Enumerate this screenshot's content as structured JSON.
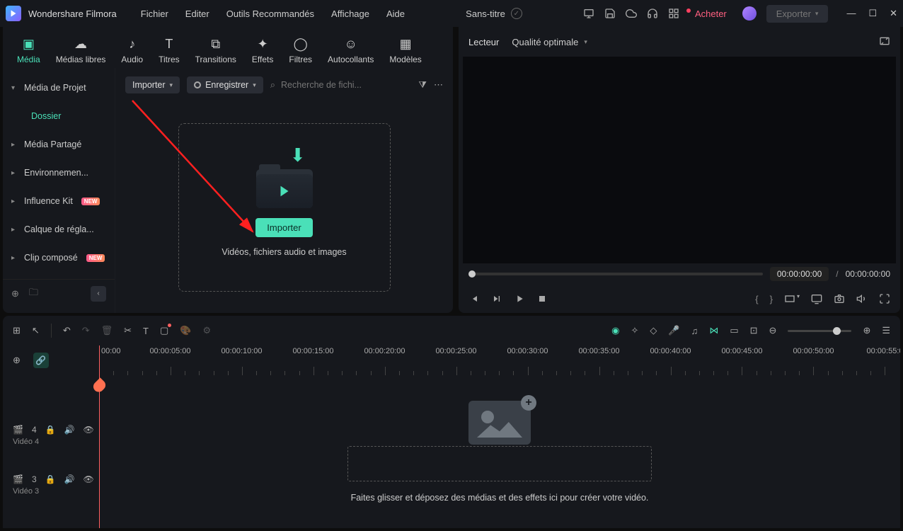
{
  "app": {
    "name": "Wondershare Filmora"
  },
  "menu": [
    "Fichier",
    "Editer",
    "Outils Recommandés",
    "Affichage",
    "Aide"
  ],
  "project": {
    "name": "Sans-titre"
  },
  "titlebar": {
    "buy": "Acheter",
    "export": "Exporter"
  },
  "tabs": [
    {
      "label": "Média",
      "active": true
    },
    {
      "label": "Médias libres"
    },
    {
      "label": "Audio"
    },
    {
      "label": "Titres"
    },
    {
      "label": "Transitions"
    },
    {
      "label": "Effets"
    },
    {
      "label": "Filtres"
    },
    {
      "label": "Autocollants"
    },
    {
      "label": "Modèles"
    }
  ],
  "sidebar": {
    "items": [
      {
        "label": "Média de Projet"
      },
      {
        "label": "Dossier",
        "child": true
      },
      {
        "label": "Média Partagé"
      },
      {
        "label": "Environnemen..."
      },
      {
        "label": "Influence Kit",
        "badge": "NEW"
      },
      {
        "label": "Calque de régla..."
      },
      {
        "label": "Clip composé",
        "badge": "NEW"
      }
    ]
  },
  "mediaToolbar": {
    "import": "Importer",
    "record": "Enregistrer",
    "searchPlaceholder": "Recherche de fichi..."
  },
  "dropzone": {
    "button": "Importer",
    "text": "Vidéos, fichiers audio et images"
  },
  "player": {
    "label": "Lecteur",
    "quality": "Qualité optimale",
    "time": "00:00:00:00",
    "duration": "00:00:00:00"
  },
  "ruler": [
    "00:00",
    "00:00:05:00",
    "00:00:10:00",
    "00:00:15:00",
    "00:00:20:00",
    "00:00:25:00",
    "00:00:30:00",
    "00:00:35:00",
    "00:00:40:00",
    "00:00:45:00",
    "00:00:50:00",
    "00:00:55:0"
  ],
  "tracks": [
    {
      "num": "4",
      "label": "Vidéo 4"
    },
    {
      "num": "3",
      "label": "Vidéo 3"
    }
  ],
  "timeline": {
    "dropHint": "Faites glisser et déposez des médias et des effets ici pour créer votre vidéo."
  }
}
